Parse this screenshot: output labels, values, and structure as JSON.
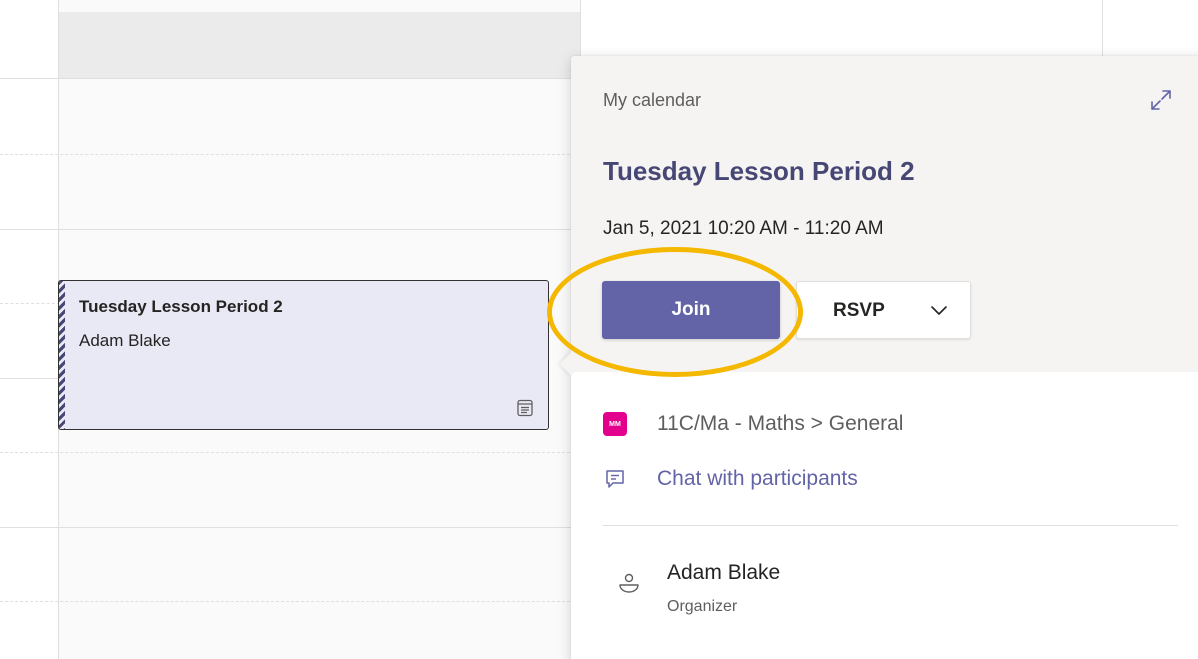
{
  "calendar": {
    "event": {
      "title": "Tuesday Lesson Period 2",
      "organizer": "Adam Blake",
      "icon": "meeting-details-icon"
    }
  },
  "popup": {
    "calendar_label": "My calendar",
    "expand_icon": "expand-icon",
    "title": "Tuesday Lesson Period 2",
    "time": "Jan 5, 2021 10:20 AM - 11:20 AM",
    "join_label": "Join",
    "rsvp_label": "RSVP",
    "rsvp_icon": "chevron-down-icon",
    "channel": {
      "badge": "MM",
      "text": "11C/Ma - Maths > General",
      "badge_color": "#e3008c"
    },
    "chat_link": "Chat with participants",
    "organizer": {
      "name": "Adam Blake",
      "role": "Organizer"
    },
    "highlight_color": "#f5b800"
  },
  "colors": {
    "accent": "#6264a7",
    "title": "#464775",
    "event_bg": "#e9e8f5"
  }
}
